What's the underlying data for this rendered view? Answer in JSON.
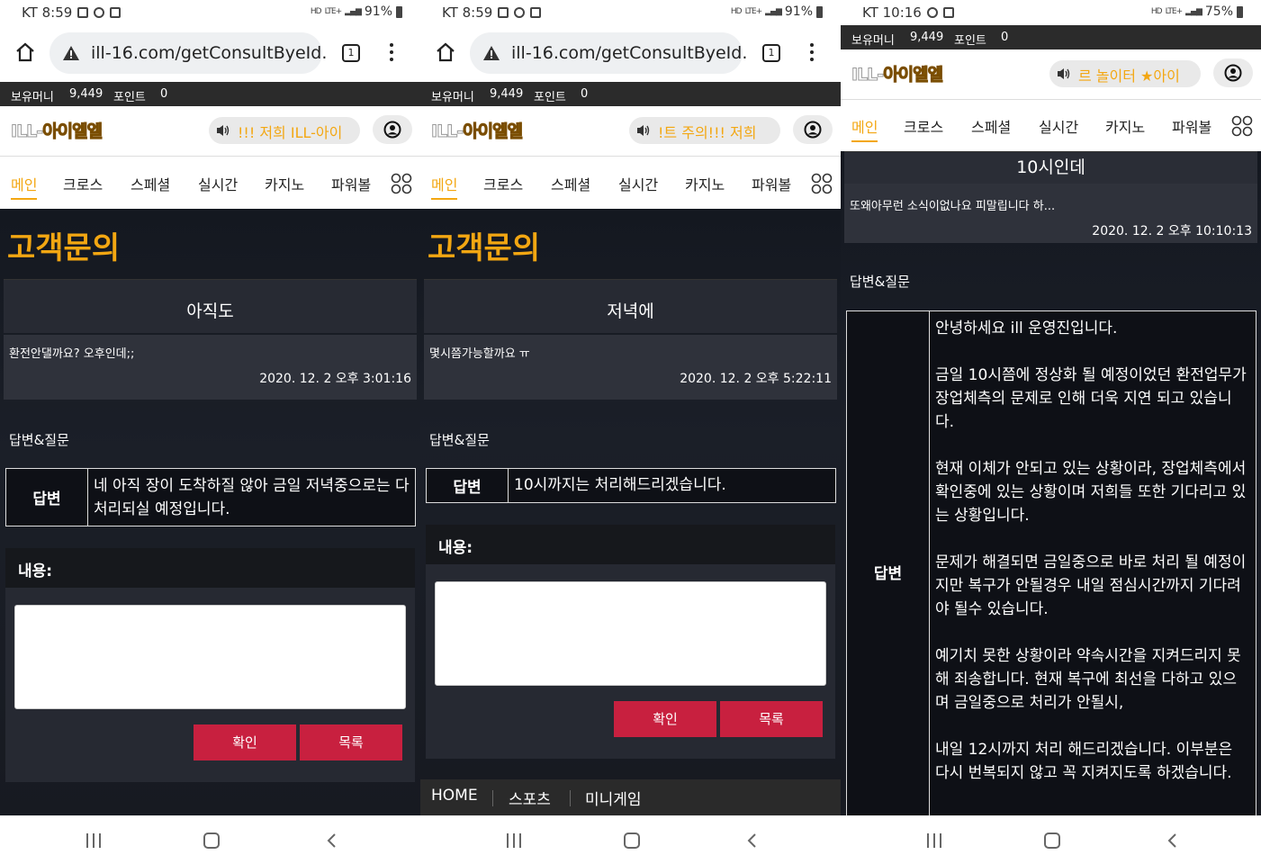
{
  "screens": [
    {
      "status": {
        "carrier_time": "KT 8:59",
        "battery": "91%",
        "lte": "LTE+"
      },
      "url": {
        "text": "ill-16.com/getConsultByeId.",
        "tab_count": "1"
      },
      "site": {
        "money_label": "보유머니",
        "money_value": "9,449",
        "point_label": "포인트",
        "point_value": "0",
        "logo_a": "ILL-",
        "logo_b": "아이엘엘",
        "marquee": "!!! 저희 ILL-아이"
      },
      "nav": [
        "메인",
        "크로스",
        "스페셜",
        "실시간",
        "카지노",
        "파워볼"
      ],
      "page_title": "고객문의",
      "inquiry": {
        "subject": "아직도",
        "question": "환전안댈까요? 오후인데;;",
        "date": "2020. 12. 2 오후 3:01:16"
      },
      "section_label": "답변&질문",
      "answer": {
        "label": "답변",
        "paragraphs": [
          "네 아직 장이 도착하질 않아 금일 저녁중으로는 다 처리되실 예정입니다."
        ]
      },
      "form": {
        "label": "내용:",
        "confirm": "확인",
        "list": "목록"
      }
    },
    {
      "status": {
        "carrier_time": "KT 8:59",
        "battery": "91%",
        "lte": "LTE+"
      },
      "url": {
        "text": "ill-16.com/getConsultByeId.",
        "tab_count": "1"
      },
      "site": {
        "money_label": "보유머니",
        "money_value": "9,449",
        "point_label": "포인트",
        "point_value": "0",
        "logo_a": "ILL-",
        "logo_b": "아이엘엘",
        "marquee": "!트 주의!!! 저희"
      },
      "nav": [
        "메인",
        "크로스",
        "스페셜",
        "실시간",
        "카지노",
        "파워볼"
      ],
      "page_title": "고객문의",
      "inquiry": {
        "subject": "저녁에",
        "question": "몇시쯤가능할까요 ㅠ",
        "date": "2020. 12. 2 오후 5:22:11"
      },
      "section_label": "답변&질문",
      "answer": {
        "label": "답변",
        "paragraphs": [
          "10시까지는 처리해드리겠습니다."
        ]
      },
      "form": {
        "label": "내용:",
        "confirm": "확인",
        "list": "목록"
      },
      "footer": [
        "HOME",
        "스포츠",
        "미니게임"
      ]
    },
    {
      "status": {
        "carrier_time": "KT 10:16",
        "battery": "75%",
        "lte": "LTE+"
      },
      "site": {
        "money_label": "보유머니",
        "money_value": "9,449",
        "point_label": "포인트",
        "point_value": "0",
        "logo_a": "ILL-",
        "logo_b": "아이엘엘",
        "marquee": "르 놀이터 ★아이"
      },
      "nav": [
        "메인",
        "크로스",
        "스페셜",
        "실시간",
        "카지노",
        "파워볼"
      ],
      "inquiry": {
        "subject": "10시인데",
        "question": "또왜아무런 소식이없나요 피말립니다 하...",
        "date": "2020. 12. 2 오후 10:10:13"
      },
      "section_label": "답변&질문",
      "answer": {
        "label": "답변",
        "paragraphs": [
          "안녕하세요 ill 운영진입니다.",
          "금일 10시쯤에 정상화 될 예정이었던 환전업무가 장업체측의 문제로 인해 더욱 지연 되고 있습니다.",
          "현재 이체가 안되고 있는 상황이라, 장업체측에서 확인중에 있는 상황이며 저희들 또한 기다리고 있는 상황입니다.",
          "문제가 해결되면 금일중으로 바로 처리 될 예정이지만 복구가 안될경우 내일 점심시간까지 기다려야 될수 있습니다.",
          "예기치 못한 상황이라 약속시간을 지켜드리지 못해 죄송합니다. 현재 복구에 최선을 다하고 있으며 금일중으로 처리가 안될시,",
          "내일 12시까지 처리 해드리겠습니다. 이부분은 다시 번복되지 않고 꼭 지켜지도록 하겠습니다."
        ]
      }
    }
  ]
}
